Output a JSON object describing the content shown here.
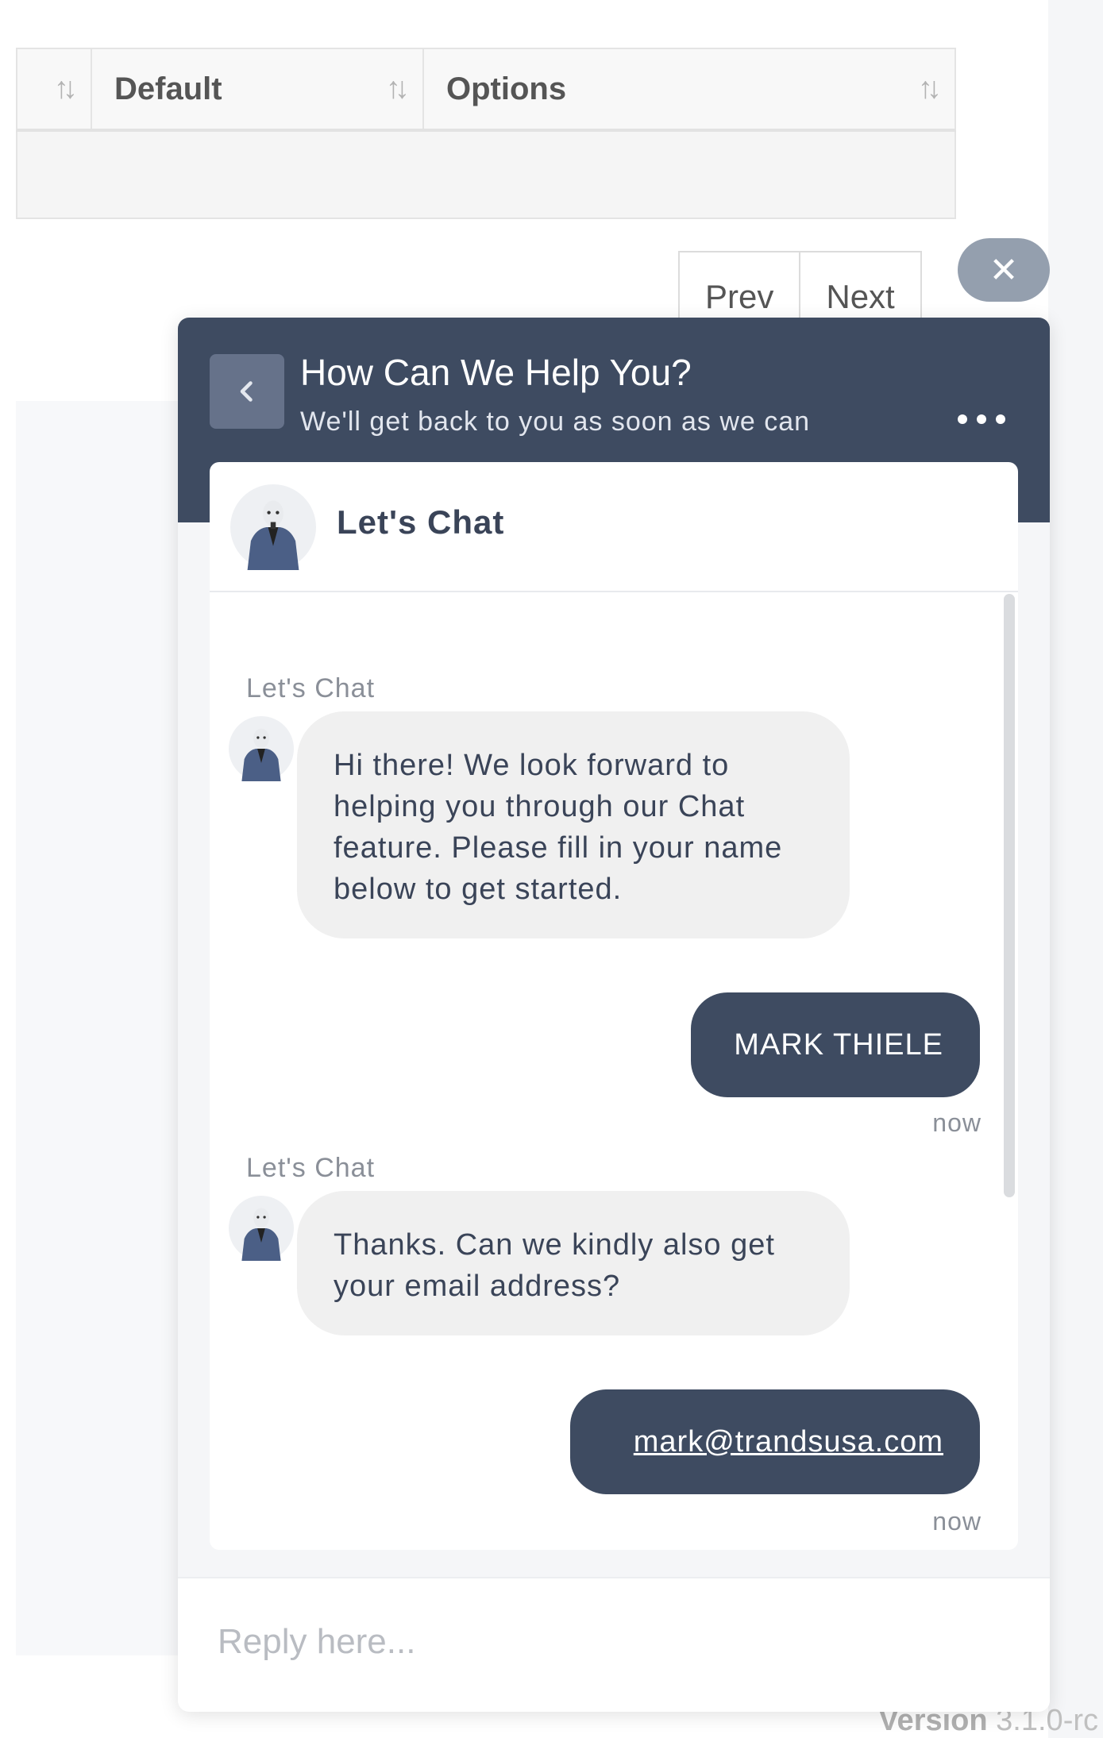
{
  "table": {
    "columns": [
      {
        "label": ""
      },
      {
        "label": "Default"
      },
      {
        "label": "Options"
      }
    ],
    "sort_icon": "sort-arrows-icon"
  },
  "pagination": {
    "prev_label": "Prev",
    "next_label": "Next"
  },
  "footer": {
    "version_label": "Version",
    "version_number": "3.1.0-rc"
  },
  "chat": {
    "close_icon": "close-icon",
    "header": {
      "title": "How Can We Help You?",
      "subtitle": "We'll get back to you as soon as we can",
      "back_icon": "chevron-left-icon",
      "more_icon": "more-options-icon"
    },
    "card_title": "Let's Chat",
    "messages": [
      {
        "from": "bot",
        "author": "Let's Chat",
        "text": "Hi there!  We look forward to helping you through our Chat feature.  Please fill in your name below to get started."
      },
      {
        "from": "user",
        "text": "MARK THIELE",
        "time": "now"
      },
      {
        "from": "bot",
        "author": "Let's Chat",
        "text": "Thanks.  Can we kindly also get your email address?"
      },
      {
        "from": "user",
        "text": "mark@trandsusa.com",
        "time": "now"
      }
    ],
    "reply_placeholder": "Reply here...",
    "colors": {
      "header_bg": "#3e4b61",
      "bubble_out": "#3e4b61",
      "bubble_in": "#f0f0f0"
    }
  }
}
